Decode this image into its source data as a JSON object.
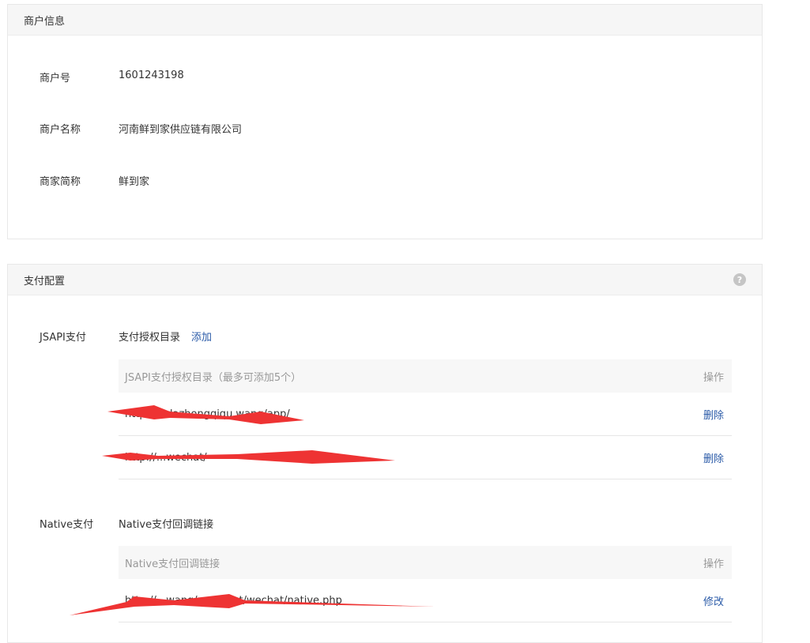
{
  "merchant": {
    "header": "商户信息",
    "rows": [
      {
        "label": "商户号",
        "value": "1601243198"
      },
      {
        "label": "商户名称",
        "value": "河南鲜到家供应链有限公司"
      },
      {
        "label": "商家简称",
        "value": "鲜到家"
      }
    ]
  },
  "payment": {
    "header": "支付配置",
    "help_icon": "?",
    "jsapi": {
      "label": "JSAPI支付",
      "title": "支付授权目录",
      "add_link": "添加",
      "table_header": "JSAPI支付授权目录（最多可添加5个）",
      "action_header": "操作",
      "rows": [
        {
          "url": "http://...dazhongqiqu.wang/app/",
          "action": "删除"
        },
        {
          "url": "http://...wechat/",
          "action": "删除"
        }
      ]
    },
    "native": {
      "label": "Native支付",
      "title": "Native支付回调链接",
      "table_header": "Native支付回调链接",
      "action_header": "操作",
      "rows": [
        {
          "url": "http://...wang/payment/wechat/native.php",
          "action": "修改"
        }
      ]
    }
  },
  "colors": {
    "link": "#2b5ba8",
    "redaction": "#ee3333"
  }
}
